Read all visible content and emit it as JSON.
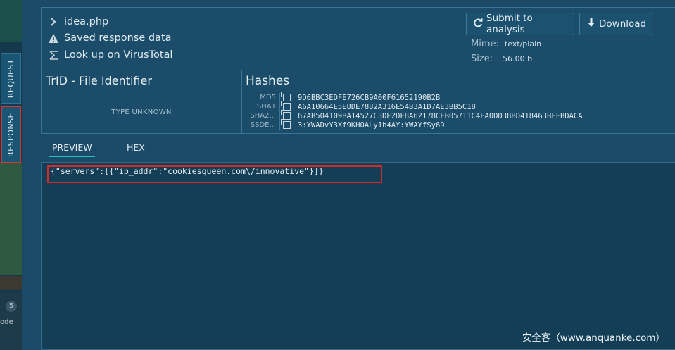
{
  "side_tabs": {
    "request": "REQUEST",
    "response": "RESPONSE"
  },
  "side_bg": {
    "badge_count": "5",
    "partial_label": "ode"
  },
  "file": {
    "name": "idea.php",
    "saved_label": "Saved response data",
    "virustotal_label": "Look up on VirusTotal"
  },
  "actions": {
    "submit_label": "Submit to analysis",
    "download_label": "Download"
  },
  "meta": {
    "mime_label": "Mime:",
    "mime_value": "text/plain",
    "size_label": "Size:",
    "size_value": "56.00 b"
  },
  "trid": {
    "title": "TrID - File Identifier",
    "value": "TYPE UNKNOWN"
  },
  "hashes": {
    "title": "Hashes",
    "rows": [
      {
        "key": "MD5",
        "value": "9D6BBC3EDFE726CB9A00F61652190B2B"
      },
      {
        "key": "SHA1",
        "value": "A6A10664E5E8DE7882A316E54B3A1D7AE3BB5C18"
      },
      {
        "key": "SHA2...",
        "value": "67AB504109BA14527C3DE2DF8A62178CFB05711C4FA0DD38BD418463BFFBDACA"
      },
      {
        "key": "SSDE...",
        "value": "3:YWADvY3Xf9KHOALy1b4AY:YWAYfSy69"
      }
    ]
  },
  "tabs": {
    "preview": "PREVIEW",
    "hex": "HEX"
  },
  "preview": {
    "content": "{\"servers\":[{\"ip_addr\":\"cookiesqueen.com\\/innovative\"}]}"
  },
  "watermark": "安全客（www.anquanke.com）",
  "colors": {
    "accent": "#2dbcc0",
    "highlight": "#d32a2a",
    "panel": "#1b4c69"
  }
}
